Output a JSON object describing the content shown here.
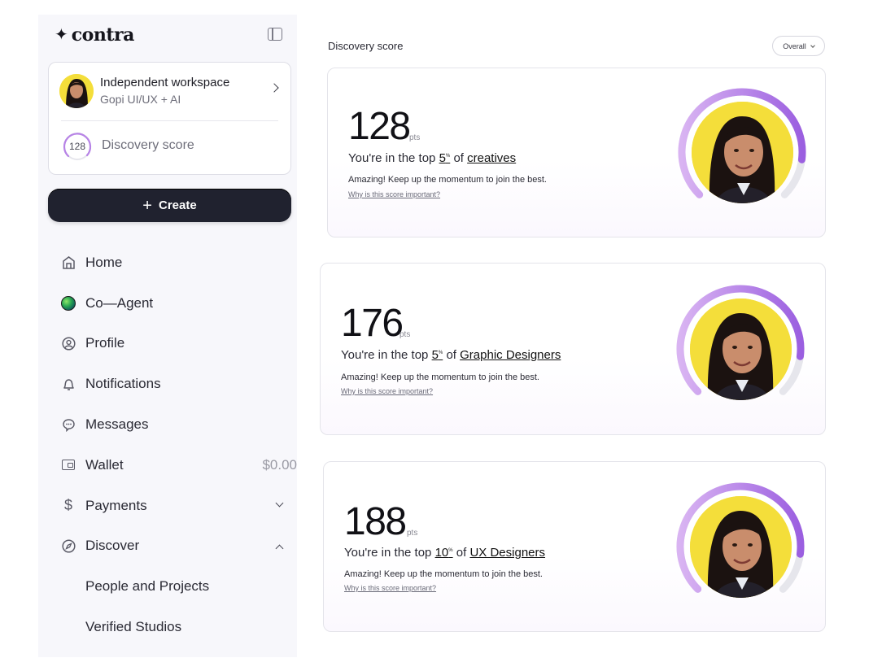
{
  "brand": {
    "mark": "✦",
    "name": "contra"
  },
  "workspace": {
    "name": "Independent workspace",
    "subtitle": "Gopi UI/UX + AI",
    "score": "128",
    "score_label": "Discovery score"
  },
  "create_button": {
    "label": "Create"
  },
  "nav": {
    "items": [
      {
        "label": "Home",
        "icon": "home-icon"
      },
      {
        "label": "Co—Agent",
        "icon": "agent-orb-icon"
      },
      {
        "label": "Profile",
        "icon": "profile-icon"
      },
      {
        "label": "Notifications",
        "icon": "bell-icon"
      },
      {
        "label": "Messages",
        "icon": "message-icon"
      },
      {
        "label": "Wallet",
        "icon": "wallet-icon",
        "value": "$0.00"
      },
      {
        "label": "Payments",
        "icon": "dollar-icon"
      },
      {
        "label": "Discover",
        "icon": "compass-icon"
      },
      {
        "label": "People and Projects"
      },
      {
        "label": "Verified Studios"
      }
    ]
  },
  "main": {
    "title": "Discovery score",
    "filter": {
      "selected": "Overall"
    },
    "cards": [
      {
        "points": "128",
        "unit": "pts",
        "prefix": "You're in the top",
        "percent": "5",
        "percent_sign": "%",
        "of": "of",
        "category": "creatives",
        "message": "Amazing! Keep up the momentum to join the best.",
        "link": "Why is this score important?",
        "progress": 0.86
      },
      {
        "points": "176",
        "unit": "pts",
        "prefix": "You're in the top",
        "percent": "5",
        "percent_sign": "%",
        "of": "of",
        "category": "Graphic Designers",
        "message": "Amazing! Keep up the momentum to join the best.",
        "link": "Why is this score important?",
        "progress": 0.86
      },
      {
        "points": "188",
        "unit": "pts",
        "prefix": "You're in the top",
        "percent": "10",
        "percent_sign": "%",
        "of": "of",
        "category": "UX Designers",
        "message": "Amazing! Keep up the momentum to join the best.",
        "link": "Why is this score important?",
        "progress": 0.86
      }
    ]
  },
  "colors": {
    "accent_purple": "#9b5fe0",
    "accent_light": "#d9b4f2",
    "avatar_yellow": "#f4de3a",
    "create_bg": "#20222f"
  }
}
